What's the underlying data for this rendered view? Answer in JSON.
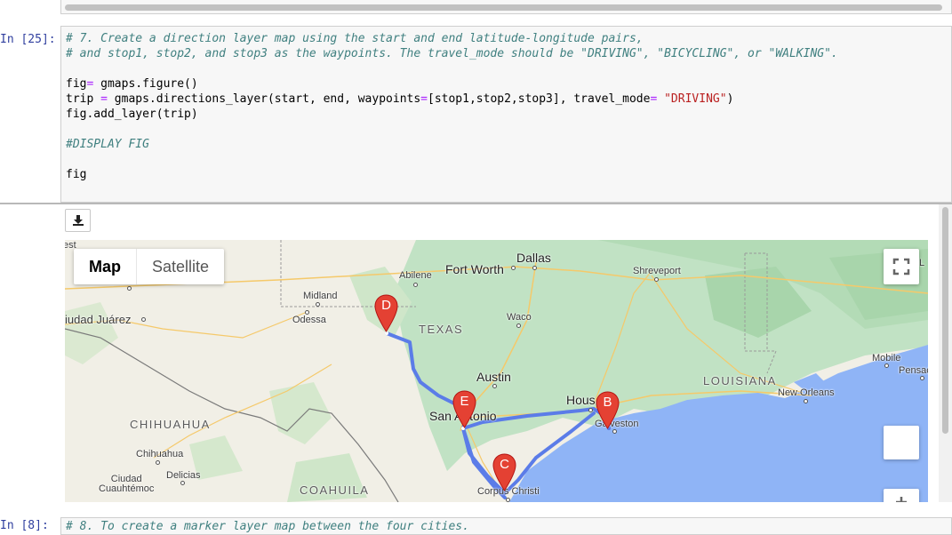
{
  "cells": {
    "cell25": {
      "prompt": "In [25]:",
      "code": {
        "line1": "# 7. Create a direction layer map using the start and end latitude-longitude pairs,",
        "line2": "# and stop1, stop2, and stop3 as the waypoints. The travel_mode should be \"DRIVING\", \"BICYCLING\", or \"WALKING\".",
        "line4_a": "fig",
        "line4_op": "=",
        "line4_b": " gmaps.figure()",
        "line5_a": "trip ",
        "line5_op": "=",
        "line5_b": " gmaps.directions_layer(start, end, waypoints",
        "line5_op2": "=",
        "line5_c": "[stop1,stop2,stop3], travel_mode",
        "line5_op3": "=",
        "line5_d": " ",
        "line5_str": "\"DRIVING\"",
        "line5_e": ")",
        "line6": "fig.add_layer(trip)",
        "line8": "#DISPLAY FIG",
        "line10": "fig"
      }
    },
    "cell8": {
      "prompt": "In [8]:",
      "code_line1": "# 8. To create a marker layer map between the four cities."
    }
  },
  "map": {
    "map_type_buttons": {
      "map": "Map",
      "satellite": "Satellite"
    },
    "labels": {
      "est": "est",
      "abilene": "Abilene",
      "fort_worth": "Fort Worth",
      "dallas": "Dallas",
      "shreveport": "Shreveport",
      "l_edge": "L",
      "midland": "Midland",
      "odessa": "Odessa",
      "ciudad_juarez": "iudad Juárez",
      "texas": "TEXAS",
      "waco": "Waco",
      "mobile": "Mobile",
      "pensacola": "Pensac",
      "austin": "Austin",
      "louisiana": "LOUISIANA",
      "new_orleans": "New Orleans",
      "houston": "Hous",
      "san_antonio": "San Antonio",
      "galveston": "Galveston",
      "chihuahua_state": "CHIHUAHUA",
      "chihuahua_city": "Chihuahua",
      "delicias": "Delicias",
      "ciudad_cuauhtemoc": "Ciudad\nCuauhtémoc",
      "coahuila": "COAHUILA",
      "corpus_christi": "Corpus Christi"
    },
    "markers": {
      "d": "D",
      "e": "E",
      "b": "B",
      "c": "C"
    },
    "colors": {
      "land": "#f1efe6",
      "green": "#c1e2c4",
      "water": "#8fb4f6",
      "route": "#5b7ce8",
      "marker": "#e44133"
    }
  },
  "icons": {
    "download": "download-icon",
    "fullscreen": "fullscreen-icon"
  }
}
